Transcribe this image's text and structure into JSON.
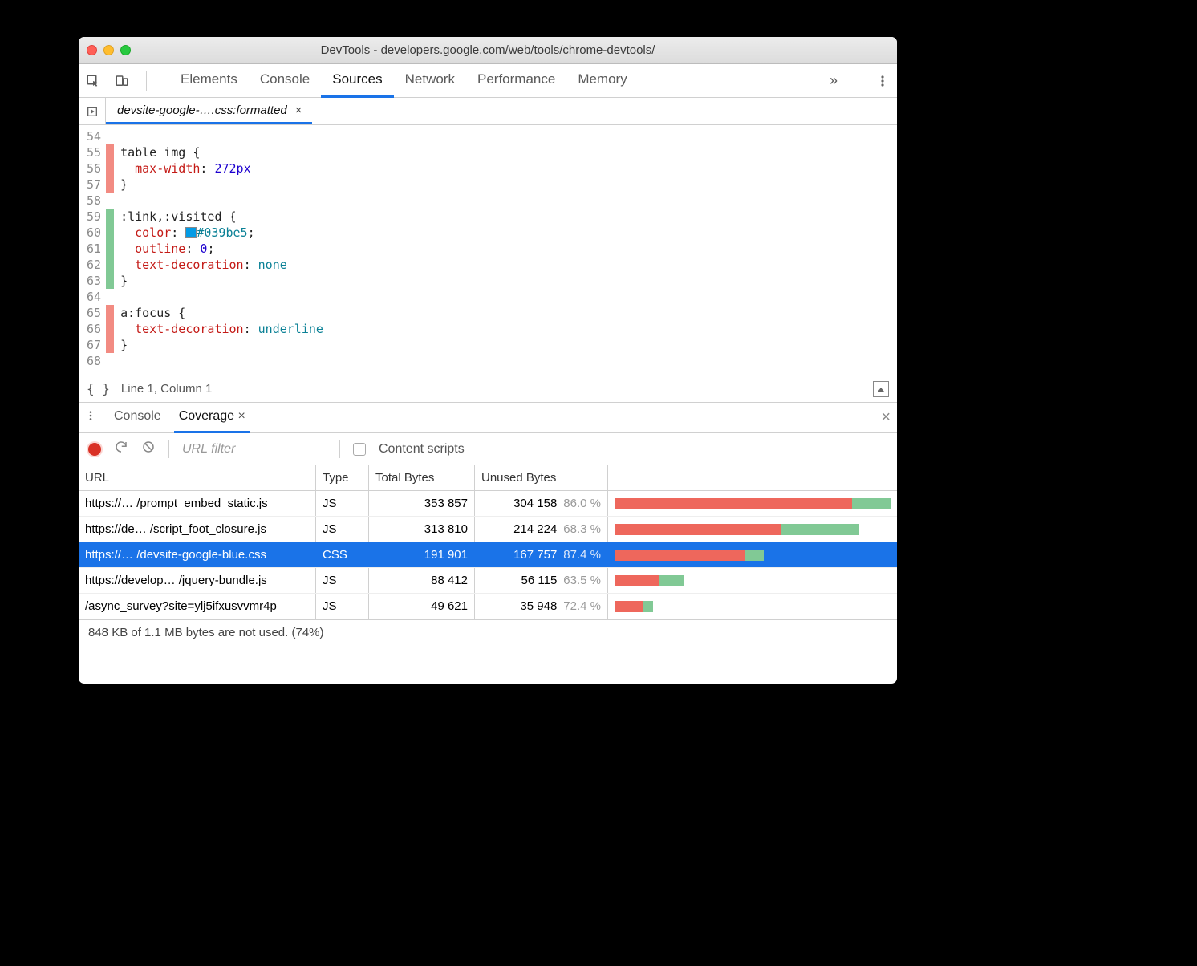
{
  "window": {
    "title": "DevTools - developers.google.com/web/tools/chrome-devtools/"
  },
  "main_tabs": [
    "Elements",
    "Console",
    "Sources",
    "Network",
    "Performance",
    "Memory"
  ],
  "main_tabs_overflow": "»",
  "active_tab": "Sources",
  "file_tab": {
    "label": "devsite-google-….css:formatted",
    "close_glyph": "×"
  },
  "code": {
    "first_line": 54,
    "lines": [
      {
        "n": 54,
        "cov": "",
        "html": ""
      },
      {
        "n": 55,
        "cov": "red",
        "html": "<span class='tok-sel'>table img</span> {"
      },
      {
        "n": 56,
        "cov": "red",
        "html": "  <span class='tok-prop'>max-width</span>: <span class='tok-val'>272px</span>"
      },
      {
        "n": 57,
        "cov": "red",
        "html": "}"
      },
      {
        "n": 58,
        "cov": "",
        "html": ""
      },
      {
        "n": 59,
        "cov": "green",
        "html": "<span class='tok-sel'>:link,:visited</span> {"
      },
      {
        "n": 60,
        "cov": "green",
        "html": "  <span class='tok-prop'>color</span>: <span class='swatch'></span><span class='tok-kw'>#039be5</span>;"
      },
      {
        "n": 61,
        "cov": "green",
        "html": "  <span class='tok-prop'>outline</span>: <span class='tok-val'>0</span>;"
      },
      {
        "n": 62,
        "cov": "green",
        "html": "  <span class='tok-prop'>text-decoration</span>: <span class='tok-kw'>none</span>"
      },
      {
        "n": 63,
        "cov": "green",
        "html": "}"
      },
      {
        "n": 64,
        "cov": "",
        "html": ""
      },
      {
        "n": 65,
        "cov": "red",
        "html": "<span class='tok-sel'>a:focus</span> {"
      },
      {
        "n": 66,
        "cov": "red",
        "html": "  <span class='tok-prop'>text-decoration</span>: <span class='tok-kw'>underline</span>"
      },
      {
        "n": 67,
        "cov": "red",
        "html": "}"
      },
      {
        "n": 68,
        "cov": "",
        "html": ""
      }
    ]
  },
  "status": {
    "braces": "{ }",
    "pos": "Line 1, Column 1"
  },
  "drawer": {
    "tabs": [
      "Console",
      "Coverage"
    ],
    "active": "Coverage",
    "close_glyph": "×",
    "tab_close_glyph": "×"
  },
  "coverage_toolbar": {
    "url_filter_placeholder": "URL filter",
    "content_scripts_label": "Content scripts"
  },
  "coverage_table": {
    "headers": {
      "url": "URL",
      "type": "Type",
      "total": "Total Bytes",
      "unused": "Unused Bytes"
    },
    "rows": [
      {
        "url": "https://… /prompt_embed_static.js",
        "type": "JS",
        "total": "353 857",
        "unused": "304 158",
        "pct": "86.0 %",
        "bar_unused": 86.0,
        "bar_scale": 1.0,
        "selected": false
      },
      {
        "url": "https://de… /script_foot_closure.js",
        "type": "JS",
        "total": "313 810",
        "unused": "214 224",
        "pct": "68.3 %",
        "bar_unused": 68.3,
        "bar_scale": 0.887,
        "selected": false
      },
      {
        "url": "https://… /devsite-google-blue.css",
        "type": "CSS",
        "total": "191 901",
        "unused": "167 757",
        "pct": "87.4 %",
        "bar_unused": 87.4,
        "bar_scale": 0.542,
        "selected": true
      },
      {
        "url": "https://develop… /jquery-bundle.js",
        "type": "JS",
        "total": "88 412",
        "unused": "56 115",
        "pct": "63.5 %",
        "bar_unused": 63.5,
        "bar_scale": 0.25,
        "selected": false
      },
      {
        "url": "/async_survey?site=ylj5ifxusvvmr4p",
        "type": "JS",
        "total": "49 621",
        "unused": "35 948",
        "pct": "72.4 %",
        "bar_unused": 72.4,
        "bar_scale": 0.14,
        "selected": false
      }
    ],
    "footer": "848 KB of 1.1 MB bytes are not used. (74%)"
  }
}
